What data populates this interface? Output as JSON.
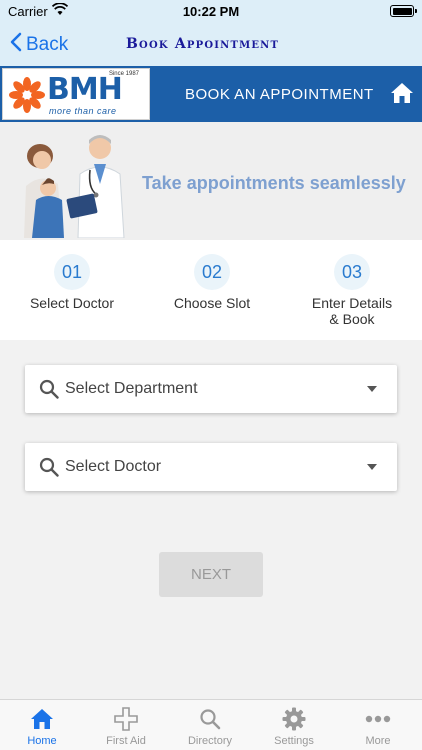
{
  "status_bar": {
    "carrier": "Carrier",
    "time": "10:22 PM"
  },
  "nav": {
    "back_label": "Back",
    "title": "Book Appointment"
  },
  "brand": {
    "logo_letters": "BMH",
    "logo_since": "Since 1987",
    "logo_tagline": "more than care",
    "heading": "BOOK AN APPOINTMENT"
  },
  "hero": {
    "tagline": "Take appointments seamlessly"
  },
  "steps": [
    {
      "number": "01",
      "label": "Select Doctor"
    },
    {
      "number": "02",
      "label": "Choose Slot"
    },
    {
      "number": "03",
      "label": "Enter Details & Book"
    }
  ],
  "form": {
    "department_placeholder": "Select Department",
    "doctor_placeholder": "Select Doctor",
    "next_label": "NEXT"
  },
  "tabs": [
    {
      "label": "Home",
      "icon": "home-icon",
      "active": true
    },
    {
      "label": "First Aid",
      "icon": "cross-icon",
      "active": false
    },
    {
      "label": "Directory",
      "icon": "search-icon",
      "active": false
    },
    {
      "label": "Settings",
      "icon": "gear-icon",
      "active": false
    },
    {
      "label": "More",
      "icon": "more-dots-icon",
      "active": false
    }
  ],
  "colors": {
    "accent": "#1a73e8",
    "brand_blue": "#1c5fa8",
    "nav_background": "#ddeef8",
    "tagline": "#7ea0d0",
    "logo_orange": "#f26522"
  }
}
